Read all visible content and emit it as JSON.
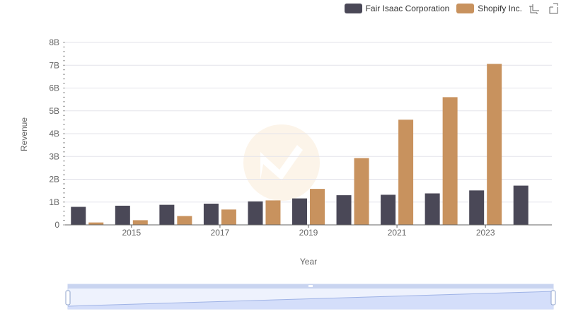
{
  "legend": {
    "series_a": "Fair Isaac Corporation",
    "series_b": "Shopify Inc."
  },
  "toolbar": {
    "icons": [
      "zoom-icon",
      "restore-icon"
    ]
  },
  "colors": {
    "series_a": "#4a4857",
    "series_b": "#c8925e",
    "grid": "#e3e3ea",
    "slider_fill": "#dbe3fb",
    "slider_border": "#c9d4f0"
  },
  "chart_data": {
    "type": "bar",
    "title": "",
    "xlabel": "Year",
    "ylabel": "Revenue",
    "categories": [
      "2014",
      "2015",
      "2016",
      "2017",
      "2018",
      "2019",
      "2020",
      "2021",
      "2022",
      "2023",
      "2024"
    ],
    "x_tick_labels": [
      "2015",
      "2017",
      "2019",
      "2021",
      "2023"
    ],
    "y_tick_labels": [
      "0",
      "1B",
      "2B",
      "3B",
      "4B",
      "5B",
      "6B",
      "7B",
      "8B"
    ],
    "ylim": [
      0,
      8000000000
    ],
    "series": [
      {
        "name": "Fair Isaac Corporation",
        "values": [
          790000000,
          840000000,
          880000000,
          930000000,
          1030000000,
          1160000000,
          1300000000,
          1320000000,
          1380000000,
          1510000000,
          1720000000
        ]
      },
      {
        "name": "Shopify Inc.",
        "values": [
          105000000,
          205000000,
          389000000,
          673000000,
          1073000000,
          1578000000,
          2929000000,
          4612000000,
          5600000000,
          7060000000,
          null
        ]
      }
    ],
    "legend_position": "top-right",
    "grid": true,
    "data_zoom_slider": true
  }
}
